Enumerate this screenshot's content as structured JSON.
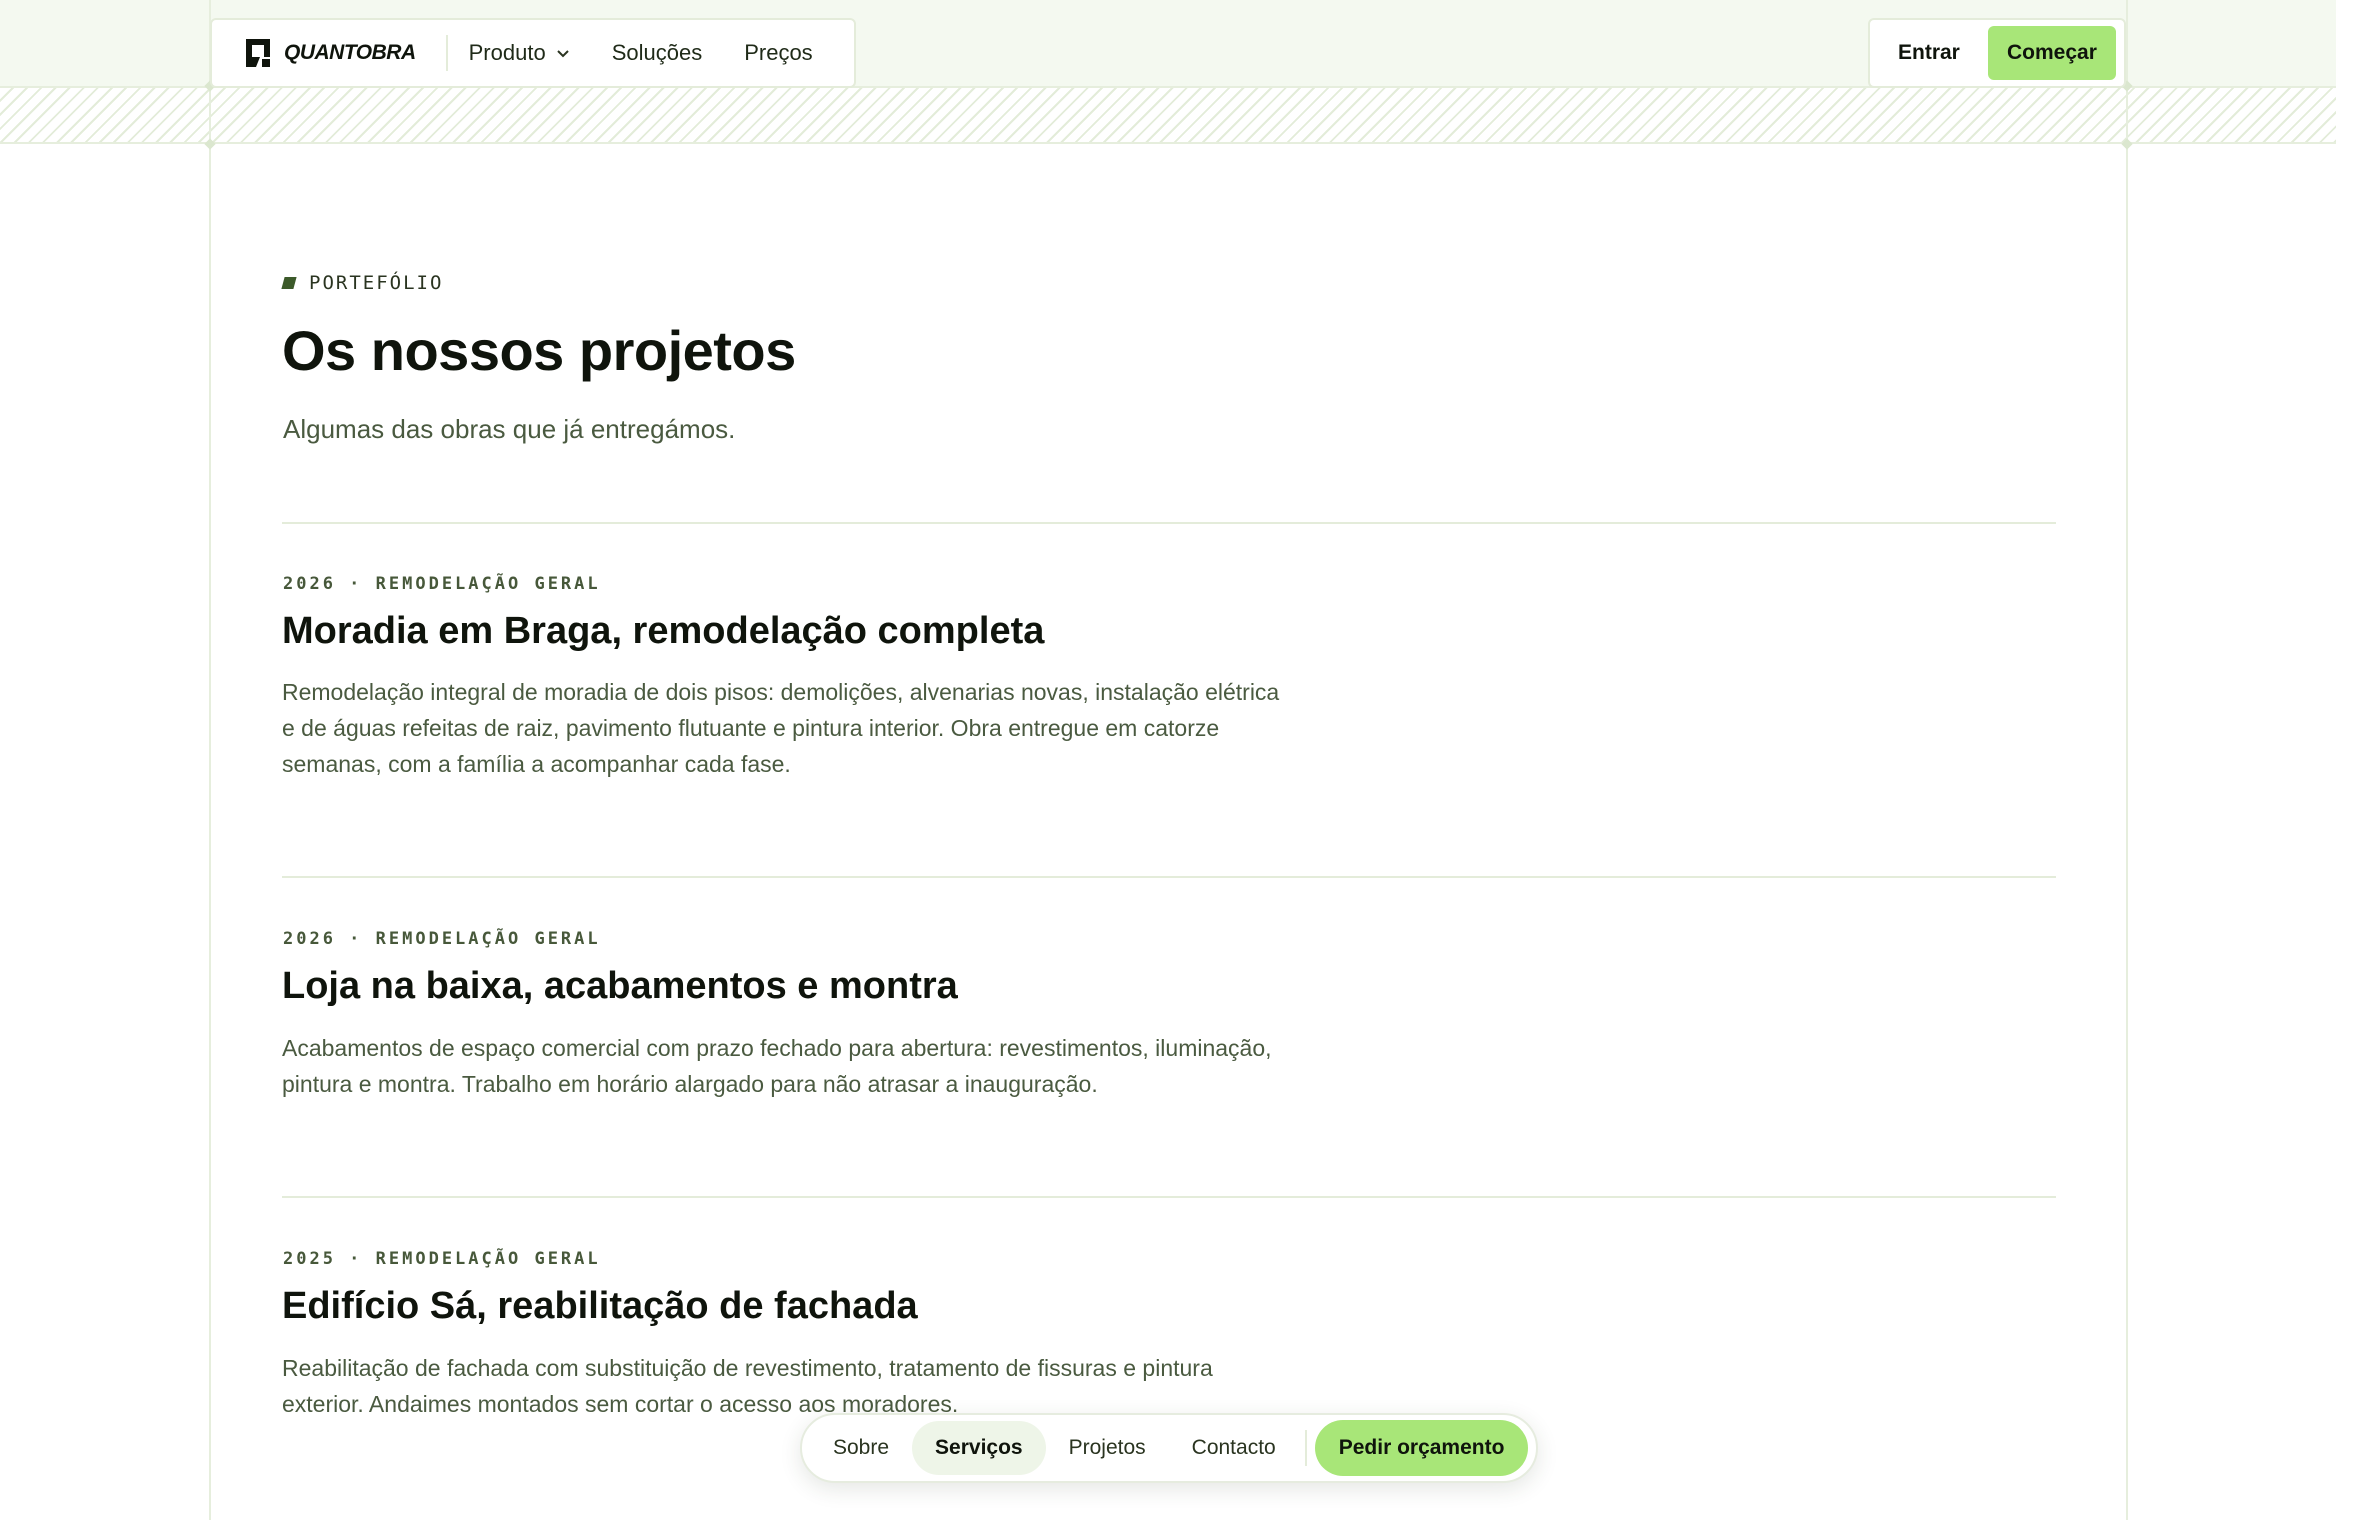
{
  "brand": {
    "name": "QUANTOBRA"
  },
  "header_nav": {
    "items": [
      {
        "label": "Produto",
        "has_dropdown": true
      },
      {
        "label": "Soluções"
      },
      {
        "label": "Preços"
      }
    ],
    "login_label": "Entrar",
    "start_label": "Começar"
  },
  "hero": {
    "eyebrow": "PORTEFÓLIO",
    "title": "Os nossos projetos",
    "subtitle": "Algumas das obras que já entregámos."
  },
  "projects": [
    {
      "meta": "2026 · REMODELAÇÃO GERAL",
      "title": "Moradia em Braga, remodelação completa",
      "description": "Remodelação integral de moradia de dois pisos: demolições, alvenarias novas, instalação elétrica e de águas refeitas de raiz, pavimento flutuante e pintura interior. Obra entregue em catorze semanas, com a família a acompanhar cada fase."
    },
    {
      "meta": "2026 · REMODELAÇÃO GERAL",
      "title": "Loja na baixa, acabamentos e montra",
      "description": "Acabamentos de espaço comercial com prazo fechado para abertura: revestimentos, iluminação, pintura e montra. Trabalho em horário alargado para não atrasar a inauguração."
    },
    {
      "meta": "2025 · REMODELAÇÃO GERAL",
      "title": "Edifício Sá, reabilitação de fachada",
      "description": "Reabilitação de fachada com substituição de revestimento, tratamento de fissuras e pintura exterior. Andaimes montados sem cortar o acesso aos moradores."
    }
  ],
  "bottom_nav": {
    "items": [
      {
        "label": "Sobre"
      },
      {
        "label": "Serviços",
        "active": true
      },
      {
        "label": "Projetos"
      },
      {
        "label": "Contacto"
      }
    ],
    "cta_label": "Pedir orçamento"
  },
  "colors": {
    "accent": "#a8e678",
    "text": "#0f140c",
    "muted": "#4a5a40",
    "band": "#f4f9f0"
  }
}
